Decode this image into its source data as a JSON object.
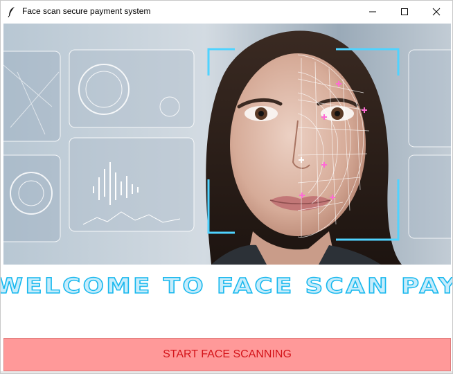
{
  "window": {
    "title": "Face scan secure payment system",
    "controls": {
      "minimize_icon": "minimize-icon",
      "maximize_icon": "maximize-icon",
      "close_icon": "close-icon"
    }
  },
  "hero": {
    "image_subject": "face-scan-illustration"
  },
  "banner": {
    "welcome_text": "WELCOME TO FACE SCAN PAY",
    "text_color": "#c6ecfb",
    "stroke_color": "#18b8ee"
  },
  "actions": {
    "start_label": "START FACE SCANNING",
    "button_color": "#ff9999",
    "label_color": "#d4141a"
  }
}
